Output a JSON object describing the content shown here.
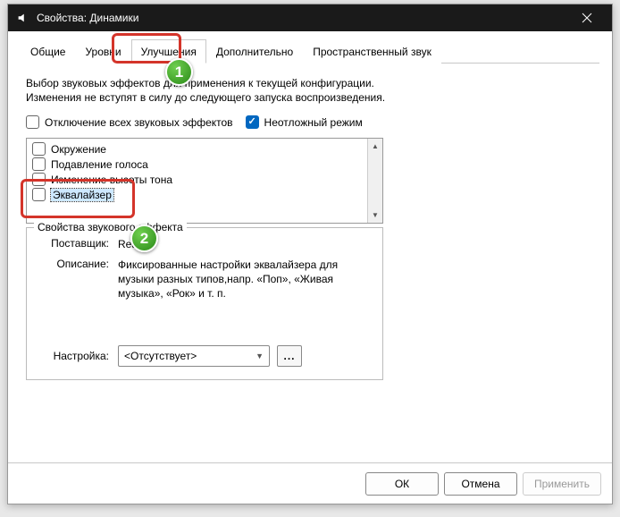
{
  "titlebar": {
    "title": "Свойства: Динамики"
  },
  "tabs": {
    "general": "Общие",
    "levels": "Уровни",
    "enhancements": "Улучшения",
    "advanced": "Дополнительно",
    "spatial": "Пространственный звук"
  },
  "panel": {
    "description": "Выбор звуковых эффектов для применения к текущей конфигурации. Изменения не вступят в силу до следующего запуска воспроизведения.",
    "disable_all": "Отключение всех звуковых эффектов",
    "immediate_mode": "Неотложный режим",
    "effects": [
      "Окружение",
      "Подавление голоса",
      "Изменение высоты тона",
      "Эквалайзер"
    ],
    "group_title": "Свойства звукового эффекта",
    "vendor_label": "Поставщик:",
    "vendor_value": "Realtek",
    "desc_label": "Описание:",
    "desc_value": "Фиксированные настройки эквалайзера для музыки разных типов,напр. «Поп», «Живая музыка», «Рок» и т. п.",
    "setting_label": "Настройка:",
    "setting_value": "<Отсутствует>",
    "more_btn": "..."
  },
  "footer": {
    "ok": "ОК",
    "cancel": "Отмена",
    "apply": "Применить"
  },
  "callouts": {
    "one": "1",
    "two": "2"
  }
}
